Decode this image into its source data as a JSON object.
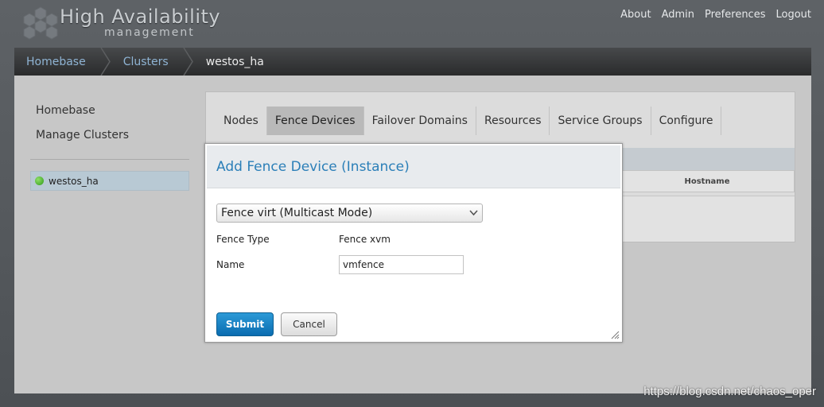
{
  "header": {
    "brand_title": "High Availability",
    "brand_subtitle": "management",
    "links": [
      "About",
      "Admin",
      "Preferences",
      "Logout"
    ]
  },
  "breadcrumb": {
    "items": [
      "Homebase",
      "Clusters"
    ],
    "current": "westos_ha"
  },
  "sidebar": {
    "items": [
      "Homebase",
      "Manage Clusters"
    ],
    "cluster": {
      "name": "westos_ha",
      "status_color": "#3aa51f"
    }
  },
  "tabs": {
    "items": [
      "Nodes",
      "Fence Devices",
      "Failover Domains",
      "Resources",
      "Service Groups",
      "Configure"
    ],
    "active": "Fence Devices"
  },
  "table": {
    "hostname_header": "Hostname"
  },
  "modal": {
    "title": "Add Fence Device (Instance)",
    "selected_device": "Fence virt (Multicast Mode)",
    "fence_type_label": "Fence Type",
    "fence_type_value": "Fence xvm",
    "name_label": "Name",
    "name_value": "vmfence",
    "submit_label": "Submit",
    "cancel_label": "Cancel"
  },
  "watermark": "https://blog.csdn.net/chaos_oper",
  "colors": {
    "accent_blue": "#2b7fb8",
    "link_blue": "#8fb4d4",
    "submit_blue": "#0a6cb0"
  }
}
